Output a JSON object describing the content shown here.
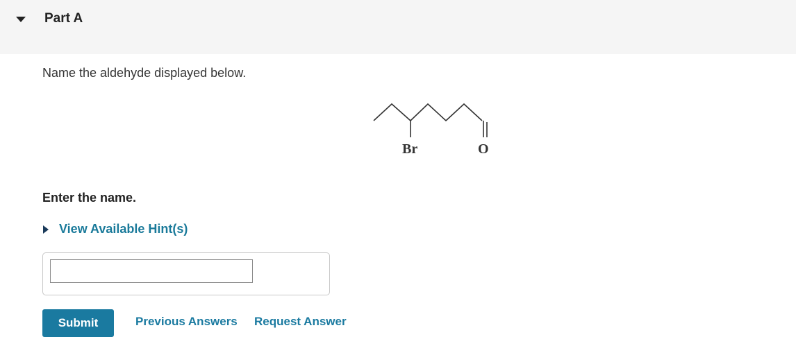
{
  "part": {
    "title": "Part A",
    "toggle_icon": "caret-down-icon"
  },
  "question": {
    "prompt": "Name the aldehyde displayed below.",
    "structure_labels": {
      "substituent": "Br",
      "oxygen": "O"
    }
  },
  "answer_section": {
    "instruction": "Enter the name.",
    "hint_label": "View Available Hint(s)",
    "hint_icon": "caret-right-icon",
    "input_value": "",
    "input_placeholder": ""
  },
  "actions": {
    "submit_label": "Submit",
    "previous_answers_label": "Previous Answers",
    "request_answer_label": "Request Answer"
  },
  "colors": {
    "header_background": "#f5f5f5",
    "link": "#1a7aa0",
    "button": "#1a7aa0"
  }
}
